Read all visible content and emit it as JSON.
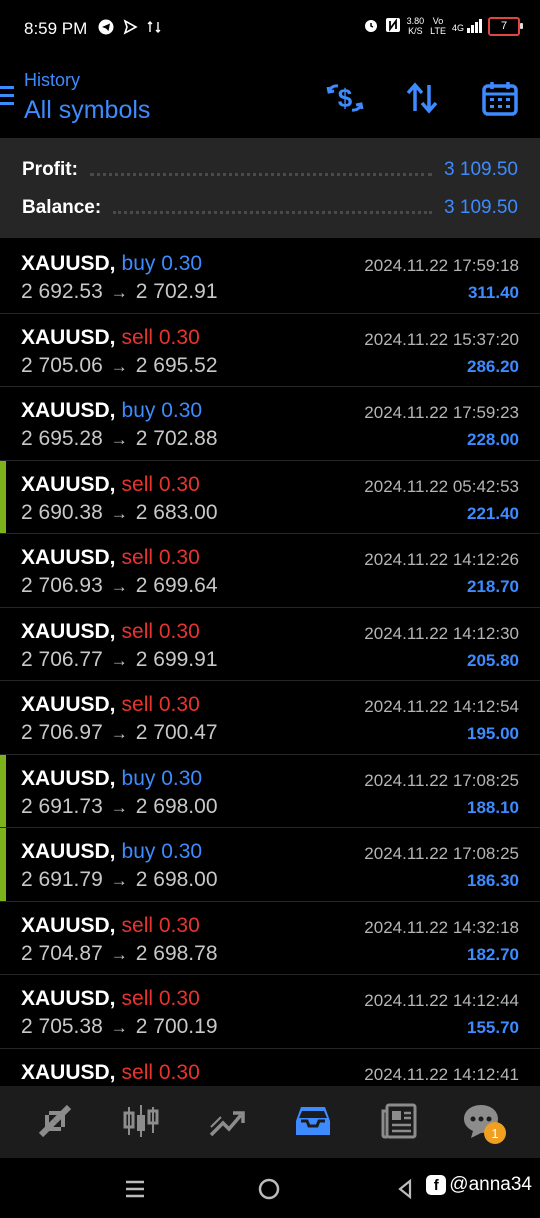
{
  "status_bar": {
    "time": "8:59 PM",
    "net_speed_top": "3.80",
    "net_speed_bottom": "K/S",
    "volte_top": "Vo",
    "volte_bottom": "LTE",
    "network": "4G",
    "battery": "7"
  },
  "header": {
    "title": "History",
    "subtitle": "All symbols",
    "icons": [
      "dollar-exchange-icon",
      "sort-icon",
      "calendar-icon"
    ],
    "accent_color": "#3d8bff"
  },
  "summary": {
    "profit_label": "Profit:",
    "profit_value": "3 109.50",
    "balance_label": "Balance:",
    "balance_value": "3 109.50"
  },
  "trades": [
    {
      "symbol": "XAUUSD,",
      "side": "buy",
      "volume": "0.30",
      "open": "2 692.53",
      "close": "2 702.91",
      "date": "2024.11.22 17:59:18",
      "profit": "311.40",
      "accent": false
    },
    {
      "symbol": "XAUUSD,",
      "side": "sell",
      "volume": "0.30",
      "open": "2 705.06",
      "close": "2 695.52",
      "date": "2024.11.22 15:37:20",
      "profit": "286.20",
      "accent": false
    },
    {
      "symbol": "XAUUSD,",
      "side": "buy",
      "volume": "0.30",
      "open": "2 695.28",
      "close": "2 702.88",
      "date": "2024.11.22 17:59:23",
      "profit": "228.00",
      "accent": false
    },
    {
      "symbol": "XAUUSD,",
      "side": "sell",
      "volume": "0.30",
      "open": "2 690.38",
      "close": "2 683.00",
      "date": "2024.11.22 05:42:53",
      "profit": "221.40",
      "accent": true
    },
    {
      "symbol": "XAUUSD,",
      "side": "sell",
      "volume": "0.30",
      "open": "2 706.93",
      "close": "2 699.64",
      "date": "2024.11.22 14:12:26",
      "profit": "218.70",
      "accent": false
    },
    {
      "symbol": "XAUUSD,",
      "side": "sell",
      "volume": "0.30",
      "open": "2 706.77",
      "close": "2 699.91",
      "date": "2024.11.22 14:12:30",
      "profit": "205.80",
      "accent": false
    },
    {
      "symbol": "XAUUSD,",
      "side": "sell",
      "volume": "0.30",
      "open": "2 706.97",
      "close": "2 700.47",
      "date": "2024.11.22 14:12:54",
      "profit": "195.00",
      "accent": false
    },
    {
      "symbol": "XAUUSD,",
      "side": "buy",
      "volume": "0.30",
      "open": "2 691.73",
      "close": "2 698.00",
      "date": "2024.11.22 17:08:25",
      "profit": "188.10",
      "accent": true
    },
    {
      "symbol": "XAUUSD,",
      "side": "buy",
      "volume": "0.30",
      "open": "2 691.79",
      "close": "2 698.00",
      "date": "2024.11.22 17:08:25",
      "profit": "186.30",
      "accent": true
    },
    {
      "symbol": "XAUUSD,",
      "side": "sell",
      "volume": "0.30",
      "open": "2 704.87",
      "close": "2 698.78",
      "date": "2024.11.22 14:32:18",
      "profit": "182.70",
      "accent": false
    },
    {
      "symbol": "XAUUSD,",
      "side": "sell",
      "volume": "0.30",
      "open": "2 705.38",
      "close": "2 700.19",
      "date": "2024.11.22 14:12:44",
      "profit": "155.70",
      "accent": false
    },
    {
      "symbol": "XAUUSD,",
      "side": "sell",
      "volume": "0.30",
      "open": "",
      "close": "",
      "date": "2024.11.22 14:12:41",
      "profit": "",
      "accent": false
    }
  ],
  "tabbar": {
    "tabs": [
      "quotes-icon",
      "chart-icon",
      "trade-icon",
      "history-icon",
      "news-icon",
      "messages-icon"
    ],
    "active": "history-icon",
    "messages_badge": "1"
  },
  "navbar": {
    "watermark": "@anna34",
    "watermark_logo": "f"
  },
  "colors": {
    "buy": "#3d8bff",
    "sell": "#e8332f",
    "accent_bar": "#7cb21b",
    "badge": "#f0a020"
  }
}
